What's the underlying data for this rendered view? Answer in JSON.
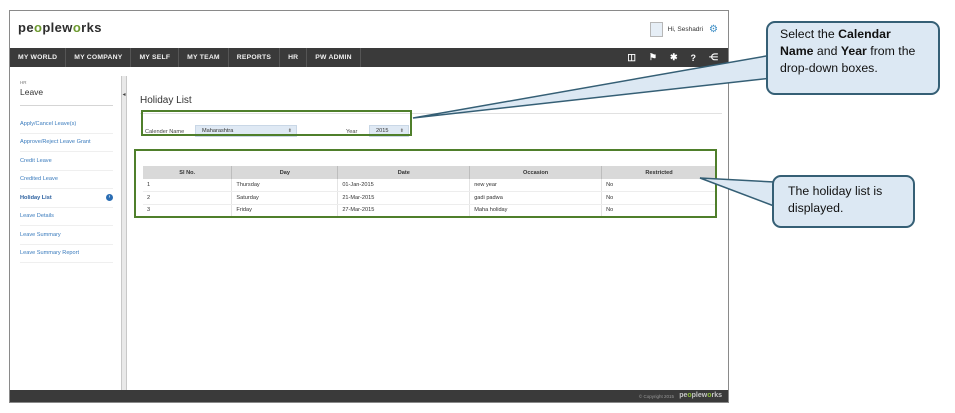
{
  "app": {
    "logo": {
      "pre": "pe",
      "o1": "o",
      "mid": "plew",
      "o2": "o",
      "post": "rks"
    },
    "user_greeting": "Hi, Seshadri"
  },
  "nav": {
    "items": [
      "MY WORLD",
      "MY COMPANY",
      "MY SELF",
      "MY TEAM",
      "REPORTS",
      "HR",
      "PW ADMIN"
    ],
    "icons": [
      "book-icon",
      "flag-icon",
      "tools-icon",
      "help-icon",
      "share-icon"
    ]
  },
  "sidebar": {
    "section_small": "HR",
    "section_title": "Leave",
    "items": [
      {
        "label": "Apply/Cancel Leave(s)"
      },
      {
        "label": "Approve/Reject Leave Grant"
      },
      {
        "label": "Credit Leave"
      },
      {
        "label": "Credited Leave"
      },
      {
        "label": "Holiday List",
        "active": true
      },
      {
        "label": "Leave Details"
      },
      {
        "label": "Leave Summary"
      },
      {
        "label": "Leave Summary Report"
      }
    ]
  },
  "main": {
    "title": "Holiday List",
    "filters": {
      "calendar_label": "Calender Name",
      "calendar_value": "Maharashtra",
      "year_label": "Year",
      "year_value": "2015"
    },
    "table": {
      "headers": [
        "Sl No.",
        "Day",
        "Date",
        "Occasion",
        "Restricted"
      ],
      "rows": [
        [
          "1",
          "Thursday",
          "01-Jan-2015",
          "new year",
          "No"
        ],
        [
          "2",
          "Saturday",
          "21-Mar-2015",
          "gadi padwa",
          "No"
        ],
        [
          "3",
          "Friday",
          "27-Mar-2015",
          "Maha holiday",
          "No"
        ]
      ]
    }
  },
  "footer": {
    "copyright": "© Copyright 2015",
    "logo": {
      "pre": "pe",
      "o1": "o",
      "mid": "plew",
      "o2": "o",
      "post": "rks"
    }
  },
  "callouts": {
    "c1": {
      "t1": "Select the ",
      "b1": "Calendar Name",
      "t2": " and ",
      "b2": "Year",
      "t3": " from the drop-down boxes."
    },
    "c2": {
      "text": "The holiday list is displayed."
    }
  }
}
